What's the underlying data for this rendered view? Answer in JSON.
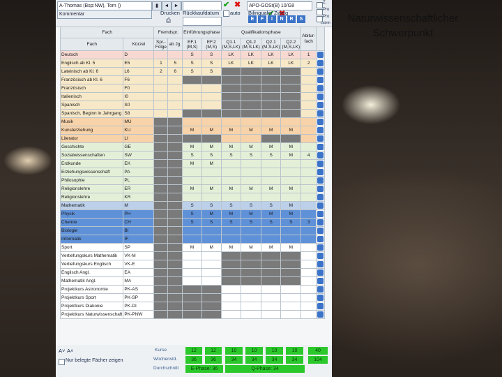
{
  "side_title": [
    "Naturwissenschaftlicher",
    "Schwerpunkt"
  ],
  "toolbar": {
    "student": "A-Thomas (Bsp:NW), Tom ()",
    "prev": "◄",
    "next": "►",
    "kommentar_label": "Kommentar",
    "drucken_label": "Drucken",
    "rueckkauf_label": "Rückkaufdatum",
    "auto_label": "auto",
    "bilingual_label": "Bilingualer Zweig",
    "apo_value": "APO-GOSt(B) 10/G8",
    "btn_e": "E",
    "btn_f": "F",
    "btn_i": "I",
    "btn_n": "N",
    "btn_r": "R",
    "btn_s": "S",
    "right_labels": [
      "Z.",
      "Pro",
      "Pro",
      "Latein"
    ]
  },
  "headers": {
    "fach_group": "Fach",
    "fremdspr": "Fremdspr.",
    "einf": "Einführungsphase",
    "qual": "Qualifikationsphase",
    "abitur": "Abitur-fach",
    "fach": "Fach",
    "kuerzel": "Kürzel",
    "sprfolge": "Spr.-Folge",
    "abjg": "ab Jg.",
    "ef1": "EF.1 (M,S)",
    "ef2": "EF.2 (M,S)",
    "q11": "Q1.1 (M,S,LK)",
    "q12": "Q1.2 (M,S,LK)",
    "q21": "Q2.1 (M,S,LK)",
    "q22": "Q2.2 (M,S,LK)"
  },
  "rows": [
    {
      "fach": "Deutsch",
      "krz": "D",
      "spr": "",
      "jg": "",
      "ef1": "S",
      "ef2": "S",
      "q11": "LK",
      "q12": "LK",
      "q21": "LK",
      "q22": "LK",
      "abi": "1",
      "color": "#f7d9d2",
      "grey": []
    },
    {
      "fach": "Englisch ab Kl. 5",
      "krz": "E5",
      "spr": "1",
      "jg": "5",
      "ef1": "S",
      "ef2": "S",
      "q11": "LK",
      "q12": "LK",
      "q21": "LK",
      "q22": "LK",
      "abi": "2",
      "color": "#f7e8c8",
      "grey": []
    },
    {
      "fach": "Lateinisch ab Kl. 6",
      "krz": "L6",
      "spr": "2",
      "jg": "6",
      "ef1": "S",
      "ef2": "S",
      "q11": "",
      "q12": "",
      "q21": "",
      "q22": "",
      "abi": "",
      "color": "#f7e8c8",
      "grey": [
        "q11",
        "q12",
        "q21",
        "q22"
      ]
    },
    {
      "fach": "Französisch ab Kl. 6",
      "krz": "F6",
      "spr": "",
      "jg": "",
      "ef1": "",
      "ef2": "",
      "q11": "",
      "q12": "",
      "q21": "",
      "q22": "",
      "abi": "",
      "color": "#f7e8c8",
      "grey": [
        "ef1",
        "ef2",
        "q11",
        "q12",
        "q21",
        "q22"
      ]
    },
    {
      "fach": "Französisch",
      "krz": "F0",
      "spr": "",
      "jg": "",
      "ef1": "",
      "ef2": "",
      "q11": "",
      "q12": "",
      "q21": "",
      "q22": "",
      "abi": "",
      "color": "#f7e8c8",
      "grey": [
        "q11",
        "q12",
        "q21",
        "q22"
      ]
    },
    {
      "fach": "Italienisch",
      "krz": "I0",
      "spr": "",
      "jg": "",
      "ef1": "",
      "ef2": "",
      "q11": "",
      "q12": "",
      "q21": "",
      "q22": "",
      "abi": "",
      "color": "#f7e8c8",
      "grey": [
        "q11",
        "q12",
        "q21",
        "q22"
      ]
    },
    {
      "fach": "Spanisch",
      "krz": "S0",
      "spr": "",
      "jg": "",
      "ef1": "",
      "ef2": "",
      "q11": "",
      "q12": "",
      "q21": "",
      "q22": "",
      "abi": "",
      "color": "#f7e8c8",
      "grey": [
        "q11",
        "q12",
        "q21",
        "q22"
      ]
    },
    {
      "fach": "Spanisch, Beginn in Jahrgang",
      "krz": "S8",
      "spr": "",
      "jg": "",
      "ef1": "",
      "ef2": "",
      "q11": "",
      "q12": "",
      "q21": "",
      "q22": "",
      "abi": "",
      "color": "#f7e8c8",
      "grey": [
        "ef1",
        "ef2",
        "q11",
        "q12",
        "q21",
        "q22"
      ]
    },
    {
      "fach": "Musik",
      "krz": "MU",
      "spr": "",
      "jg": "",
      "ef1": "",
      "ef2": "",
      "q11": "",
      "q12": "",
      "q21": "",
      "q22": "",
      "abi": "",
      "color": "#f8d2a8",
      "grey": [
        "spr",
        "jg"
      ]
    },
    {
      "fach": "Kunsterziehung",
      "krz": "KU",
      "spr": "",
      "jg": "",
      "ef1": "M",
      "ef2": "M",
      "q11": "M",
      "q12": "M",
      "q21": "M",
      "q22": "M",
      "abi": "",
      "color": "#f8d2a8",
      "grey": [
        "spr",
        "jg"
      ]
    },
    {
      "fach": "Literatur",
      "krz": "LI",
      "spr": "",
      "jg": "",
      "ef1": "",
      "ef2": "",
      "q11": "",
      "q12": "",
      "q21": "",
      "q22": "",
      "abi": "",
      "color": "#f8d2a8",
      "grey": [
        "spr",
        "jg",
        "ef1",
        "ef2",
        "q21",
        "q22"
      ]
    },
    {
      "fach": "Geschichte",
      "krz": "GE",
      "spr": "",
      "jg": "",
      "ef1": "M",
      "ef2": "M",
      "q11": "M",
      "q12": "M",
      "q21": "M",
      "q22": "M",
      "abi": "",
      "color": "#e4efd8",
      "grey": [
        "spr",
        "jg"
      ]
    },
    {
      "fach": "Sozialwissenschaften",
      "krz": "SW",
      "spr": "",
      "jg": "",
      "ef1": "S",
      "ef2": "S",
      "q11": "S",
      "q12": "S",
      "q21": "S",
      "q22": "M",
      "abi": "4",
      "color": "#e4efd8",
      "grey": [
        "spr",
        "jg"
      ]
    },
    {
      "fach": "Erdkunde",
      "krz": "EK",
      "spr": "",
      "jg": "",
      "ef1": "M",
      "ef2": "M",
      "q11": "",
      "q12": "",
      "q21": "",
      "q22": "",
      "abi": "",
      "color": "#e4efd8",
      "grey": [
        "spr",
        "jg"
      ]
    },
    {
      "fach": "Erziehungswissenschaft",
      "krz": "PA",
      "spr": "",
      "jg": "",
      "ef1": "",
      "ef2": "",
      "q11": "",
      "q12": "",
      "q21": "",
      "q22": "",
      "abi": "",
      "color": "#e4efd8",
      "grey": [
        "spr",
        "jg"
      ]
    },
    {
      "fach": "Philosophie",
      "krz": "PL",
      "spr": "",
      "jg": "",
      "ef1": "",
      "ef2": "",
      "q11": "",
      "q12": "",
      "q21": "",
      "q22": "",
      "abi": "",
      "color": "#e4efd8",
      "grey": [
        "spr",
        "jg"
      ]
    },
    {
      "fach": "Religionslehre",
      "krz": "ER",
      "spr": "",
      "jg": "",
      "ef1": "M",
      "ef2": "M",
      "q11": "M",
      "q12": "M",
      "q21": "M",
      "q22": "M",
      "abi": "",
      "color": "#e4efd8",
      "grey": [
        "spr",
        "jg"
      ]
    },
    {
      "fach": "Religionslehre",
      "krz": "KR",
      "spr": "",
      "jg": "",
      "ef1": "",
      "ef2": "",
      "q11": "",
      "q12": "",
      "q21": "",
      "q22": "",
      "abi": "",
      "color": "#e4efd8",
      "grey": [
        "spr",
        "jg"
      ]
    },
    {
      "fach": "Mathematik",
      "krz": "M",
      "spr": "",
      "jg": "",
      "ef1": "S",
      "ef2": "S",
      "q11": "S",
      "q12": "S",
      "q21": "S",
      "q22": "M",
      "abi": "",
      "color": "#bcd0ea",
      "grey": [
        "spr",
        "jg"
      ]
    },
    {
      "fach": "Physik",
      "krz": "PH",
      "spr": "",
      "jg": "",
      "ef1": "S",
      "ef2": "M",
      "q11": "M",
      "q12": "M",
      "q21": "M",
      "q22": "M",
      "abi": "",
      "color": "#5f91d8",
      "grey": [
        "spr",
        "jg"
      ]
    },
    {
      "fach": "Chemie",
      "krz": "CH",
      "spr": "",
      "jg": "",
      "ef1": "S",
      "ef2": "S",
      "q11": "S",
      "q12": "S",
      "q21": "S",
      "q22": "S",
      "abi": "3",
      "color": "#5f91d8",
      "grey": [
        "spr",
        "jg"
      ]
    },
    {
      "fach": "Biologie",
      "krz": "BI",
      "spr": "",
      "jg": "",
      "ef1": "",
      "ef2": "",
      "q11": "",
      "q12": "",
      "q21": "",
      "q22": "",
      "abi": "",
      "color": "#5f91d8",
      "grey": [
        "spr",
        "jg"
      ]
    },
    {
      "fach": "Informatik",
      "krz": "IF",
      "spr": "",
      "jg": "",
      "ef1": "",
      "ef2": "",
      "q11": "",
      "q12": "",
      "q21": "",
      "q22": "",
      "abi": "",
      "color": "#5f91d8",
      "grey": [
        "spr",
        "jg"
      ]
    },
    {
      "fach": "Sport",
      "krz": "SP",
      "spr": "",
      "jg": "",
      "ef1": "M",
      "ef2": "M",
      "q11": "M",
      "q12": "M",
      "q21": "M",
      "q22": "M",
      "abi": "",
      "color": "#ffffff",
      "grey": [
        "spr",
        "jg"
      ]
    },
    {
      "fach": "Vertiefungskurs Mathematik",
      "krz": "VK-M",
      "spr": "",
      "jg": "",
      "ef1": "",
      "ef2": "",
      "q11": "",
      "q12": "",
      "q21": "",
      "q22": "",
      "abi": "",
      "color": "#ffffff",
      "grey": [
        "spr",
        "jg",
        "q11",
        "q12",
        "q21",
        "q22"
      ]
    },
    {
      "fach": "Vertiefungskurs Englisch",
      "krz": "VK-E",
      "spr": "",
      "jg": "",
      "ef1": "",
      "ef2": "",
      "q11": "",
      "q12": "",
      "q21": "",
      "q22": "",
      "abi": "",
      "color": "#ffffff",
      "grey": [
        "spr",
        "jg",
        "q11",
        "q12",
        "q21",
        "q22"
      ]
    },
    {
      "fach": "Englisch Angl.",
      "krz": "EA",
      "spr": "",
      "jg": "",
      "ef1": "",
      "ef2": "",
      "q11": "",
      "q12": "",
      "q21": "",
      "q22": "",
      "abi": "",
      "color": "#ffffff",
      "grey": [
        "spr",
        "jg",
        "q11",
        "q12",
        "q21",
        "q22"
      ]
    },
    {
      "fach": "Mathematik Angl.",
      "krz": "MA",
      "spr": "",
      "jg": "",
      "ef1": "",
      "ef2": "",
      "q11": "",
      "q12": "",
      "q21": "",
      "q22": "",
      "abi": "",
      "color": "#ffffff",
      "grey": [
        "spr",
        "jg",
        "q11",
        "q12",
        "q21",
        "q22"
      ]
    },
    {
      "fach": "Projektkurs Astronomie",
      "krz": "PK-AS",
      "spr": "",
      "jg": "",
      "ef1": "",
      "ef2": "",
      "q11": "",
      "q12": "",
      "q21": "",
      "q22": "",
      "abi": "",
      "color": "#ffffff",
      "grey": [
        "spr",
        "jg",
        "ef1",
        "ef2"
      ]
    },
    {
      "fach": "Projektkurs Sport",
      "krz": "PK-SP",
      "spr": "",
      "jg": "",
      "ef1": "",
      "ef2": "",
      "q11": "",
      "q12": "",
      "q21": "",
      "q22": "",
      "abi": "",
      "color": "#ffffff",
      "grey": [
        "spr",
        "jg",
        "ef1",
        "ef2"
      ]
    },
    {
      "fach": "Projektkurs Diakonie",
      "krz": "PK-DI",
      "spr": "",
      "jg": "",
      "ef1": "",
      "ef2": "",
      "q11": "",
      "q12": "",
      "q21": "",
      "q22": "",
      "abi": "",
      "color": "#ffffff",
      "grey": [
        "spr",
        "jg",
        "ef1",
        "ef2"
      ]
    },
    {
      "fach": "Projektkurs Naturwissenschaft",
      "krz": "PK-PNW",
      "spr": "",
      "jg": "",
      "ef1": "",
      "ef2": "",
      "q11": "",
      "q12": "",
      "q21": "",
      "q22": "",
      "abi": "",
      "color": "#ffffff",
      "grey": [
        "spr",
        "jg",
        "ef1",
        "ef2"
      ]
    }
  ],
  "footer": {
    "nur_belegte": "Nur belegte Fächer zeigen",
    "kurse_label": "Kurse",
    "wochenstd_label": "Wochenstd.",
    "durchschnitt_label": "Durchschnitt",
    "kurse": [
      "12",
      "12",
      "10",
      "10",
      "10",
      "10",
      "40"
    ],
    "wochenstd": [
      "36",
      "36",
      "34",
      "34",
      "34",
      "34",
      "104"
    ],
    "e_phase": "E-Phase: 36",
    "q_phase": "Q-Phase: 34"
  }
}
